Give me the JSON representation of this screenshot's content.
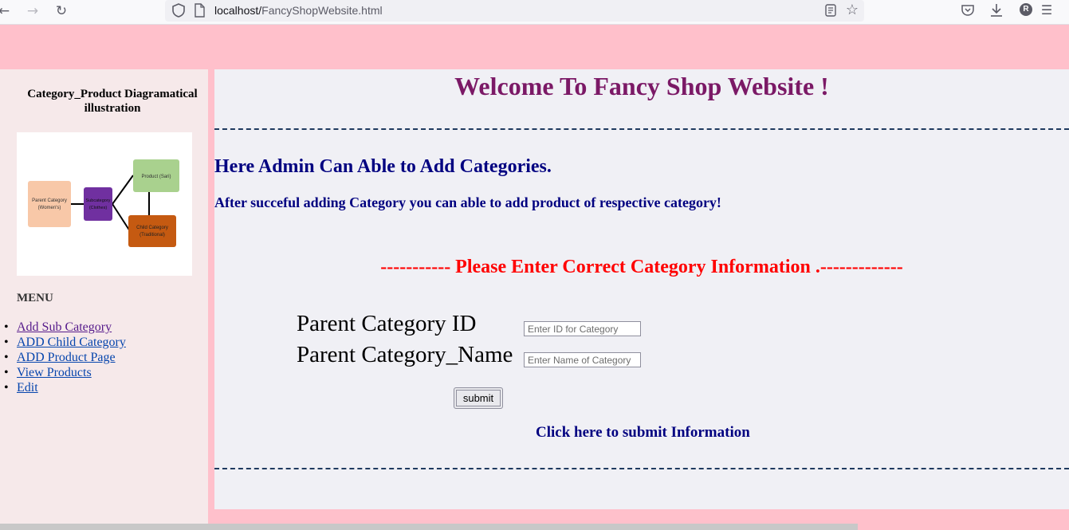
{
  "browser": {
    "url_host": "localhost/",
    "url_path": "FancyShopWebsite.html",
    "profile_initial": "R",
    "icons": [
      "back-arrow-icon",
      "forward-arrow-icon",
      "reload-icon",
      "shield-icon",
      "page-icon",
      "reader-view-icon",
      "star-icon",
      "pocket-icon",
      "download-icon",
      "hamburger-menu-icon"
    ]
  },
  "sidebar": {
    "title": "Category_Product Diagramatical illustration",
    "diagram": {
      "parent": [
        "Parent Category",
        "(Women's)"
      ],
      "sub": [
        "Subcategory",
        "(Clothes)"
      ],
      "product": "Product (Sari)",
      "child": [
        "Child Category",
        "(Traditional)"
      ]
    },
    "menu_heading": "MENU",
    "menu_items": [
      {
        "label": "Add Sub Category"
      },
      {
        "label": "ADD Child Category"
      },
      {
        "label": "ADD Product Page"
      },
      {
        "label": "View Products"
      },
      {
        "label": "Edit"
      }
    ]
  },
  "main": {
    "welcome": "Welcome To Fancy Shop Website !",
    "heading": "Here Admin Can Able to Add Categories.",
    "subtext": "After succeful adding Category you can able to add product of respective category!",
    "notice": "----------- Please Enter Correct Category Information .-------------",
    "form": {
      "id_label": "Parent Category ID",
      "id_placeholder": "Enter ID for Category",
      "id_value": "",
      "name_label": "Parent Category_Name",
      "name_placeholder": "Enter Name of Category",
      "name_value": "",
      "submit_label": "submit"
    },
    "click_info": "Click here to submit Information"
  },
  "colors": {
    "page_bg": "#ffc0cb",
    "sidebar_bg": "#f6e9ea",
    "main_bg": "#f0f0f5",
    "welcome": "#7b1966",
    "heading": "#000080",
    "notice": "#ff0000",
    "link": "#0645ad"
  }
}
